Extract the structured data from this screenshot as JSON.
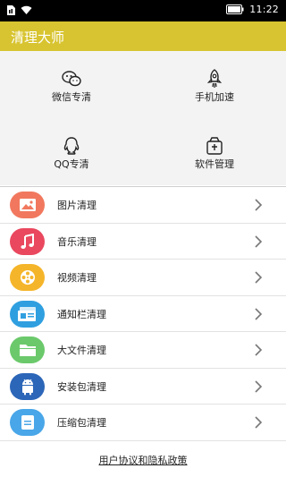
{
  "status": {
    "time": "11:22"
  },
  "app": {
    "title": "清理大师"
  },
  "grid": [
    {
      "label": "微信专清",
      "icon": "wechat-icon"
    },
    {
      "label": "手机加速",
      "icon": "rocket-icon"
    },
    {
      "label": "QQ专清",
      "icon": "qq-icon"
    },
    {
      "label": "软件管理",
      "icon": "app-box-icon"
    }
  ],
  "list": [
    {
      "label": "图片清理",
      "icon": "image-icon",
      "color": "#f1785e"
    },
    {
      "label": "音乐清理",
      "icon": "music-icon",
      "color": "#e9485e"
    },
    {
      "label": "视频清理",
      "icon": "film-reel-icon",
      "color": "#f5b52a"
    },
    {
      "label": "通知栏清理",
      "icon": "notification-bar-icon",
      "color": "#2f9fe0"
    },
    {
      "label": "大文件清理",
      "icon": "folder-icon",
      "color": "#6bc96b"
    },
    {
      "label": "安装包清理",
      "icon": "android-icon",
      "color": "#2c66b8"
    },
    {
      "label": "压缩包清理",
      "icon": "archive-icon",
      "color": "#49a6e8"
    }
  ],
  "footer": {
    "link": "用户协议和隐私政策"
  },
  "colors": {
    "accent": "#d8c430",
    "grid_bg": "#f3f3f3"
  }
}
